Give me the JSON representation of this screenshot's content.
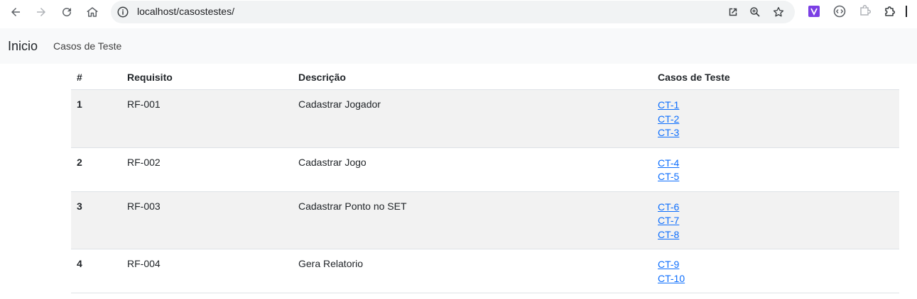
{
  "browser": {
    "url": "localhost/casostestes/"
  },
  "navbar": {
    "brand": "Inicio",
    "link": "Casos de Teste"
  },
  "table": {
    "headers": [
      "#",
      "Requisito",
      "Descrição",
      "Casos de Teste"
    ],
    "rows": [
      {
        "num": "1",
        "req": "RF-001",
        "desc": "Cadastrar Jogador",
        "cases": [
          "CT-1",
          "CT-2",
          "CT-3"
        ]
      },
      {
        "num": "2",
        "req": "RF-002",
        "desc": "Cadastrar Jogo",
        "cases": [
          "CT-4",
          "CT-5"
        ]
      },
      {
        "num": "3",
        "req": "RF-003",
        "desc": "Cadastrar Ponto no SET",
        "cases": [
          "CT-6",
          "CT-7",
          "CT-8"
        ]
      },
      {
        "num": "4",
        "req": "RF-004",
        "desc": "Gera Relatorio",
        "cases": [
          "CT-9",
          "CT-10"
        ]
      }
    ]
  },
  "colors": {
    "link": "#0d6efd",
    "stripe": "#f2f2f2",
    "navbar_bg": "#f8f9fa",
    "omnibox_bg": "#f1f3f4",
    "extension_purple": "#7b3fe4"
  }
}
